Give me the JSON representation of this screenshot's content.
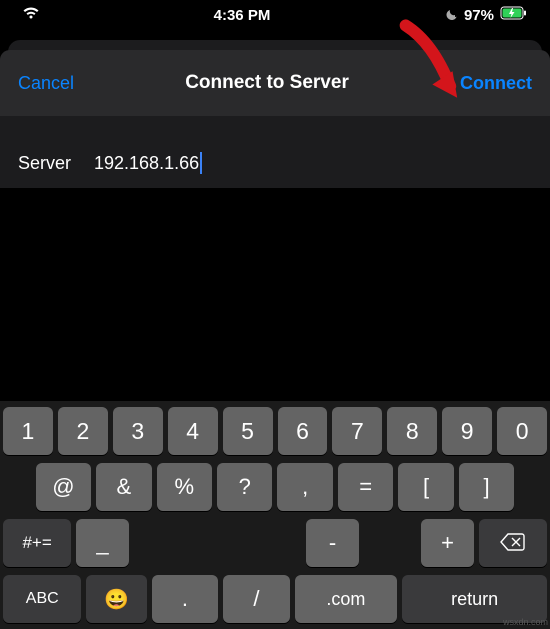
{
  "status": {
    "time": "4:36 PM",
    "battery_pct": "97%"
  },
  "nav": {
    "cancel": "Cancel",
    "title": "Connect to Server",
    "connect": "Connect"
  },
  "form": {
    "label": "Server",
    "value": "192.168.1.66"
  },
  "keyboard": {
    "row1": [
      "1",
      "2",
      "3",
      "4",
      "5",
      "6",
      "7",
      "8",
      "9",
      "0"
    ],
    "row2": [
      "@",
      "&",
      "%",
      "?",
      ",",
      "=",
      "[",
      "]"
    ],
    "row3_shift": "#+=",
    "row3": [
      "_",
      "\\",
      "|",
      "~",
      "<",
      ">",
      "€",
      "£",
      "¥"
    ],
    "row3b": [
      "_",
      "-",
      "+"
    ],
    "row4_abc": "ABC",
    "row4_emoji": "😀",
    "row4_dot": ".",
    "row4_slash": "/",
    "row4_com": ".com",
    "row4_return": "return"
  },
  "watermark": "wsxdn.com"
}
